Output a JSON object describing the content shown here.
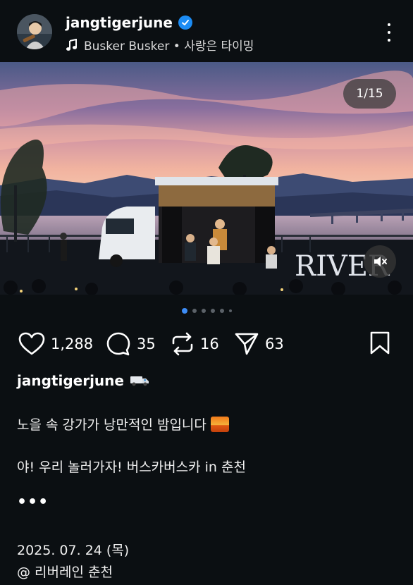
{
  "header": {
    "username": "jangtigerjune",
    "music": "Busker Busker • 사랑은 타이밍",
    "icons": {
      "verified": "verified-badge-icon",
      "music": "music-note-icon",
      "more": "more-vertical-icon",
      "avatar": "avatar"
    }
  },
  "media": {
    "counter": "1/15",
    "sign_text": "RIVER",
    "mute_icon": "muted-speaker-icon"
  },
  "carousel": {
    "total_dots": 6,
    "active_index": 0
  },
  "actions": {
    "likes": "1,288",
    "comments": "35",
    "reposts": "16",
    "shares": "63",
    "icons": [
      "heart-icon",
      "comment-icon",
      "repost-icon",
      "send-icon",
      "bookmark-icon"
    ]
  },
  "caption": {
    "username": "jangtigerjune",
    "line1": "노을 속 강가가 낭만적인 밤입니다",
    "line2": "야! 우리 놀러가자! 버스카버스카 in 춘천",
    "more": "•••",
    "date": "2025. 07. 24 (목)",
    "location": "@ 리버레인 춘천"
  },
  "colors": {
    "background": "#0b0f12",
    "accent": "#3d8cf6",
    "verified": "#1c8cf4"
  }
}
